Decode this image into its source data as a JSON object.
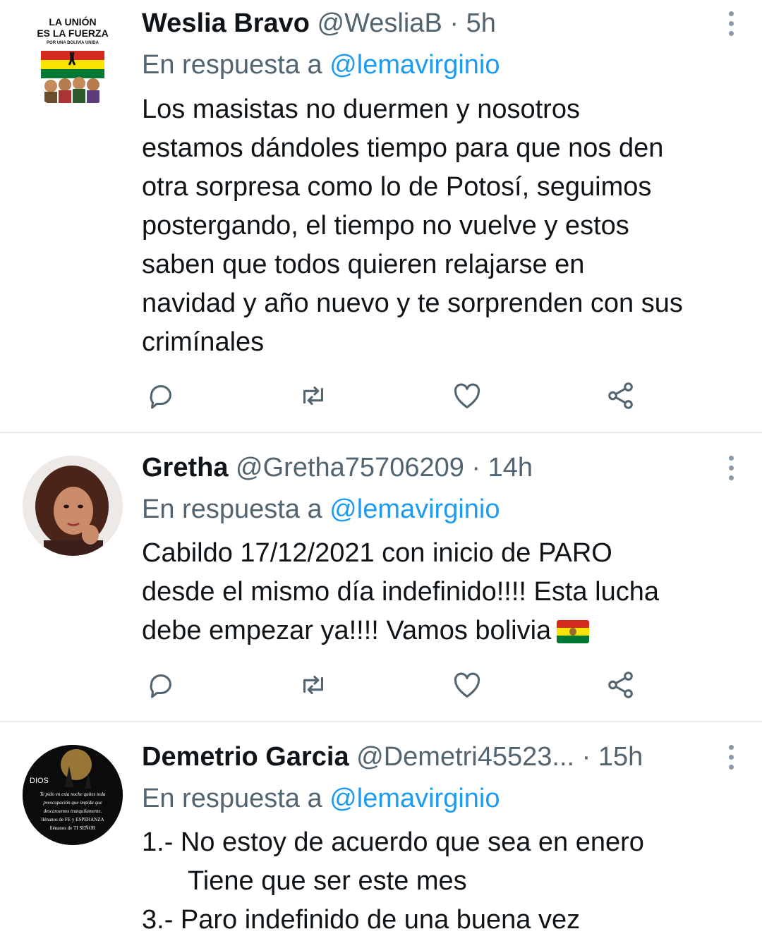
{
  "tweets": [
    {
      "name": "Weslia Bravo",
      "handle": "@WesliaB",
      "separator": " · ",
      "time": "5h",
      "reply_prefix": "En respuesta a ",
      "reply_mention": "@lemavirginio",
      "lines": [
        "Los masistas no duermen y nosotros",
        "estamos dándoles tiempo para que nos den",
        "otra sorpresa como lo de Potosí, seguimos",
        "postergando, el tiempo no vuelve y estos",
        "saben que todos quieren relajarse en",
        "navidad y año nuevo y te sorprenden con sus",
        "crimínales"
      ],
      "avatar_text": [
        "LA UNIÓN",
        "ES LA FUERZA",
        "POR UNA BOLIVIA UNIDA"
      ]
    },
    {
      "name": "Gretha",
      "handle": "@Gretha75706209",
      "separator": " · ",
      "time": "14h",
      "reply_prefix": "En respuesta a ",
      "reply_mention": "@lemavirginio",
      "lines": [
        "Cabildo 17/12/2021 con inicio de PARO",
        "desde el mismo día indefinido!!!! Esta lucha",
        "debe empezar ya!!!! Vamos bolivia"
      ]
    },
    {
      "name": "Demetrio Garcia",
      "handle": "@Demetri45523...",
      "separator": " · ",
      "time": "15h",
      "reply_prefix": "En respuesta a ",
      "reply_mention": "@lemavirginio",
      "lines": [
        "1.- No estoy de acuerdo que sea en enero",
        "Tiene que ser este mes",
        "3.- Paro indefinido de una buena vez"
      ],
      "avatar_text": [
        "DIOS",
        "Te pido en esta noche quites toda",
        "preocupación que impida que",
        "descansemos tranquilamente.",
        "llénanos de FE y ESPERANZA",
        "llénanos de TI SEÑOR"
      ]
    }
  ],
  "icons": [
    "reply-icon",
    "retweet-icon",
    "like-icon",
    "share-icon",
    "more-options-icon",
    "bolivia-flag-icon"
  ],
  "colors": {
    "link": "#1d9bf0",
    "secondary": "#536471",
    "text": "#0f1419",
    "divider": "#e6ecf0"
  }
}
